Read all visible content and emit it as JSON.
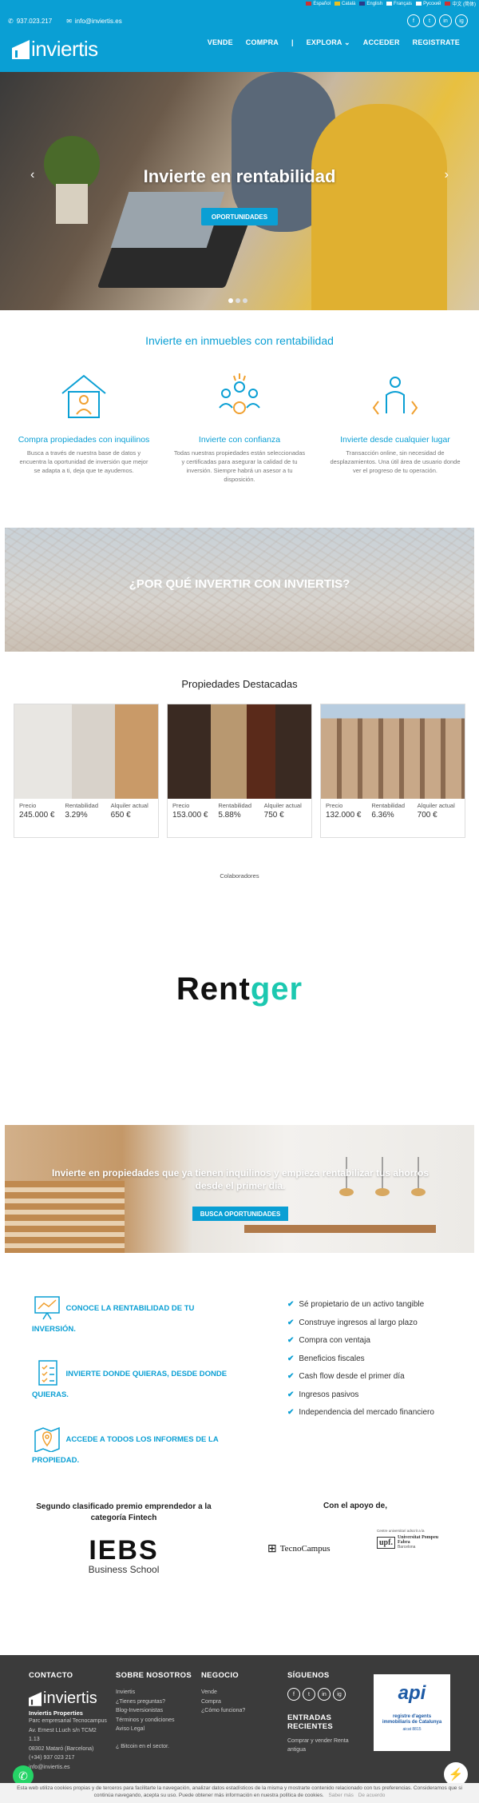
{
  "header": {
    "languages": [
      "Español",
      "Català",
      "English",
      "Français",
      "Pусский",
      "中文 (简体)"
    ],
    "phone": "937.023.217",
    "email": "info@inviertis.es",
    "logo_text": "inviertis",
    "social": [
      "f",
      "t",
      "in",
      "ig"
    ],
    "nav": [
      "VENDE",
      "COMPRA",
      "|",
      "EXPLORA",
      "ACCEDER",
      "REGISTRATE"
    ]
  },
  "hero": {
    "title": "Invierte en rentabilidad",
    "button": "OPORTUNIDADES",
    "prev": "‹",
    "next": "›"
  },
  "intro": {
    "title": "Invierte en inmuebles con rentabilidad",
    "features": [
      {
        "title": "Compra propiedades con inquilinos",
        "text": "Busca a través de nuestra base de datos y encuentra la oportunidad de inversión que mejor se adapta a ti, deja que te ayudemos."
      },
      {
        "title": "Invierte con confianza",
        "text": "Todas nuestras propiedades están seleccionadas y certificadas para asegurar la calidad de tu inversión. Siempre habrá un asesor a tu disposición."
      },
      {
        "title": "Invierte desde cualquier lugar",
        "text": "Transacción online, sin necesidad de desplazamientos. Una útil área de usuario donde ver el progreso de tu operación."
      }
    ]
  },
  "why": {
    "title": "¿POR QUÉ INVERTIR CON INVIERTIS?"
  },
  "featured": {
    "title": "Propiedades Destacadas",
    "labels": {
      "price": "Precio",
      "yield": "Rentabilidad",
      "rent": "Alquiler actual"
    },
    "cards": [
      {
        "price": "245.000 €",
        "yield": "3.29%",
        "rent": "650 €"
      },
      {
        "price": "153.000 €",
        "yield": "5.88%",
        "rent": "750 €"
      },
      {
        "price": "132.000 €",
        "yield": "6.36%",
        "rent": "700 €"
      }
    ]
  },
  "partners": {
    "title": "Colaboradores",
    "logo_a": "Rent",
    "logo_b": "ger"
  },
  "cta": {
    "title": "Invierte en propiedades que ya tienen inquilinos y empieza rentabilizar tus ahorros desde el primer día.",
    "button": "BUSCA OPORTUNIDADES"
  },
  "services": [
    "CONOCE LA RENTABILIDAD DE TU INVERSIÓN.",
    "INVIERTE DONDE QUIERAS, DESDE DONDE QUIERAS.",
    "ACCEDE A TODOS LOS INFORMES DE LA PROPIEDAD."
  ],
  "benefits": [
    "Sé propietario de un activo tangible",
    "Construye ingresos al largo plazo",
    "Compra con ventaja",
    "Beneficios fiscales",
    "Cash flow desde el primer día",
    "Ingresos pasivos",
    "Independencia del mercado financiero"
  ],
  "awards": {
    "award_title": "Segundo clasificado premio emprendedor a la categoría Fintech",
    "iebs": "IEBS",
    "iebs_sub": "Business School",
    "support_title": "Con el apoyo de,",
    "tecno": "TecnoCampus",
    "upf_caption": "Centre universitari adscrit a la",
    "upf": "Universitat Pompeu Fabra",
    "upf_sub": "Barcelona"
  },
  "footer": {
    "contact_h": "CONTACTO",
    "company": "Inviertis Properties",
    "address": [
      "Parc empresarial Tecnocampus",
      "Av. Ernest LLuch s/n TCM2 1.13",
      "08302 Mataró (Barcelona)",
      "(+34) 937 023 217",
      "info@inviertis.es"
    ],
    "about_h": "SOBRE NOSOTROS",
    "about": [
      "Inviertis",
      "¿Tienes preguntas?",
      "Blog-Inversionistas",
      "Términos y condiciones",
      "Aviso Legal",
      "",
      "¿ Bitcoin en el sector."
    ],
    "biz_h": "NEGOCIO",
    "biz": [
      "Vende",
      "Compra",
      "¿Cómo funciona?"
    ],
    "follow_h": "SÍGUENOS",
    "recent_h": "ENTRADAS RECIENTES",
    "recent": [
      "Comprar y vender Renta antigua"
    ],
    "api_text": "api",
    "api_sub": "registre d'agents immobiliaris de Catalunya",
    "api_num": "aicat 8815"
  },
  "cookie": {
    "text": "Esta web utiliza cookies propias y de terceros para facilitarte la navegación, analizar datos estadísticos de la misma y mostrarte contenido relacionado con tus preferencias. Consideramos que si continúa navegando, acepta su uso. Puede obtener más información en nuestra política de cookies.",
    "more": "Saber más",
    "ok": "De acuerdo"
  },
  "colors": {
    "brand": "#0a9fd4",
    "footer": "#3b3b3b"
  }
}
